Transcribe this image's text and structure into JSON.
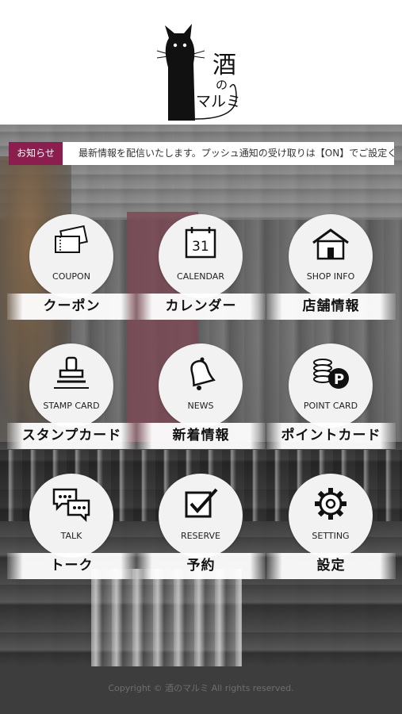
{
  "header": {
    "logo_kanji": "酒",
    "logo_no": "の",
    "logo_name": "マルミ"
  },
  "news": {
    "tag": "お知らせ",
    "ticker": "最新情報を配信いたします。プッシュ通知の受け取りは【ON】でご設定ください。"
  },
  "menu": [
    {
      "en": "COUPON",
      "jp": "クーポン",
      "icon": "coupon-icon"
    },
    {
      "en": "CALENDAR",
      "jp": "カレンダー",
      "icon": "calendar-icon",
      "day": "31"
    },
    {
      "en": "SHOP INFO",
      "jp": "店舗情報",
      "icon": "shop-icon"
    },
    {
      "en": "STAMP CARD",
      "jp": "スタンプカード",
      "icon": "stamp-icon"
    },
    {
      "en": "NEWS",
      "jp": "新着情報",
      "icon": "bell-icon"
    },
    {
      "en": "POINT CARD",
      "jp": "ポイントカード",
      "icon": "coin-icon",
      "coin_letter": "P"
    },
    {
      "en": "TALK",
      "jp": "トーク",
      "icon": "chat-icon"
    },
    {
      "en": "RESERVE",
      "jp": "予約",
      "icon": "checkbox-icon"
    },
    {
      "en": "SETTING",
      "jp": "設定",
      "icon": "gear-icon"
    }
  ],
  "footer": {
    "copyright": "Copyright © 酒のマルミ All rights reserved."
  },
  "colors": {
    "accent": "#8c1d4f",
    "footer_bg": "#3d3d3d"
  }
}
